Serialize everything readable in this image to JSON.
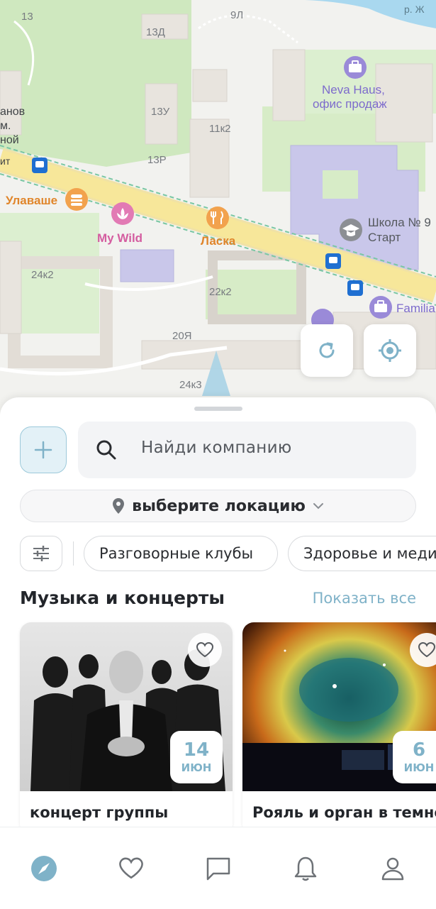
{
  "map": {
    "house_labels": [
      "13",
      "13Д",
      "9Л",
      "13У",
      "13Р",
      "11к2",
      "24к2",
      "22к2",
      "20Я",
      "24к3"
    ],
    "pois": [
      {
        "name": "Улавашe",
        "icon": "burger-icon"
      },
      {
        "name": "My Wild",
        "icon": "lotus-icon"
      },
      {
        "name": "Ласка",
        "icon": "fork-knife-icon"
      },
      {
        "name_line1": "Neva Haus,",
        "name_line2": "офис продаж",
        "icon": "briefcase-icon"
      },
      {
        "name_line1": "Школа № 9",
        "name_line2": "Старт",
        "icon": "graduation-cap-icon"
      },
      {
        "name": "Familia",
        "icon": "briefcase-icon"
      }
    ],
    "partial_labels": [
      "анов",
      "м.",
      "ной",
      "ит",
      "р. Ж"
    ],
    "colors": {
      "park": "#cfe8bf",
      "building": "#e8e4de",
      "water": "#a9d8ef",
      "road": "#f7e79a",
      "poi_purple": "#9a8ad8",
      "poi_orange": "#f2a24d",
      "poi_pink": "#e27ab4",
      "poi_gray": "#8c8f94",
      "transit": "#1f6fd1"
    }
  },
  "map_controls": {
    "refresh_icon": "refresh-icon",
    "locate_icon": "crosshair-icon"
  },
  "search": {
    "placeholder": "Найди компанию",
    "icon": "search-icon"
  },
  "location": {
    "label": "выберите локацию",
    "icon": "pin-icon",
    "chevron": "chevron-down-icon"
  },
  "chips": [
    "Разговорные клубы",
    "Здоровье и медицина"
  ],
  "section": {
    "title": "Музыка и концерты",
    "show_all": "Показать все"
  },
  "cards": [
    {
      "title": "концерт группы",
      "day": "14",
      "month": "ИЮН"
    },
    {
      "title": "Рояль и орган в темноте",
      "day": "6",
      "month": "ИЮН"
    }
  ],
  "nav": [
    {
      "name": "explore",
      "icon": "compass-icon",
      "active": true
    },
    {
      "name": "favorites",
      "icon": "heart-icon",
      "active": false
    },
    {
      "name": "messages",
      "icon": "chat-icon",
      "active": false
    },
    {
      "name": "notifications",
      "icon": "bell-icon",
      "active": false
    },
    {
      "name": "profile",
      "icon": "user-icon",
      "active": false
    }
  ],
  "colors": {
    "accent": "#7fb2c8",
    "text": "#22252a"
  }
}
